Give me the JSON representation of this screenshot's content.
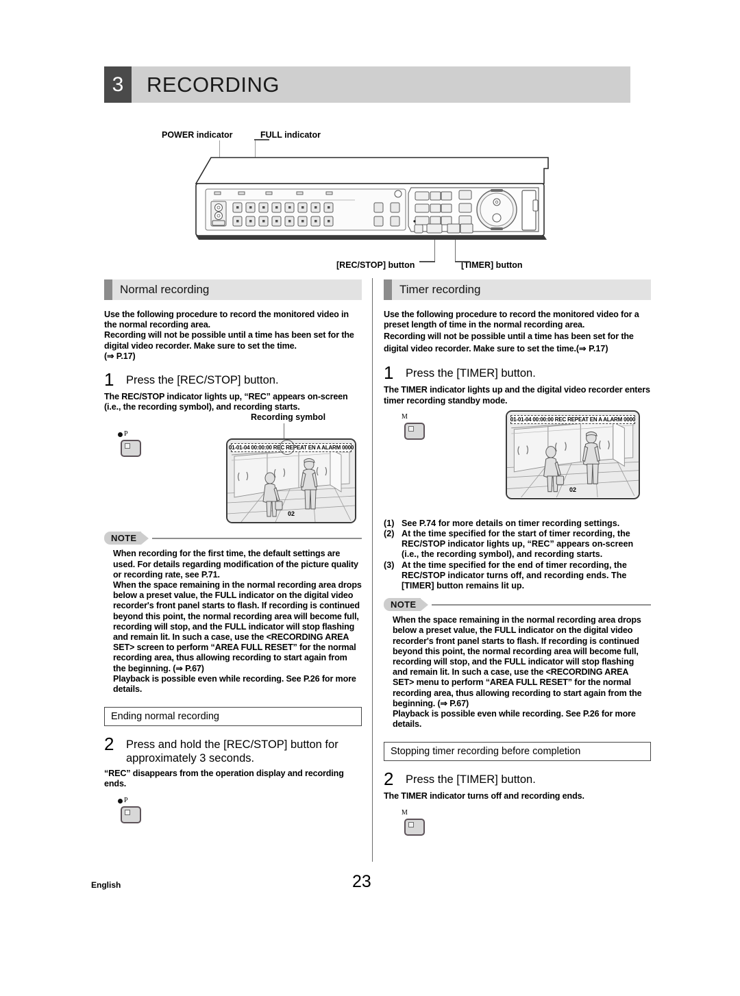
{
  "chapter": {
    "number": "3",
    "title": "RECORDING"
  },
  "device_callouts": {
    "power": "POWER indicator",
    "full": "FULL indicator",
    "recstop": "[REC/STOP] button",
    "timer": "[TIMER] button"
  },
  "left_column": {
    "section_title": "Normal recording",
    "intro": "Use the following procedure to record the monitored video in the normal recording area.",
    "intro2": "Recording will not be possible until a time has been set for the digital video recorder. Make sure to set the time.",
    "intro_ref": "(⇒ P.17)",
    "step1_num": "1",
    "step1_text": "Press the [REC/STOP] button.",
    "step1_desc": "The REC/STOP indicator lights up, “REC” appears on-screen (i.e., the recording symbol), and recording starts.",
    "button_dot_label": "P",
    "screen_label": "Recording symbol",
    "osd_text": "01-01-04 00:00:00 REC REPEAT EN A ALARM 0000",
    "camera_number": "02",
    "note_caption": "NOTE",
    "note_p1": "When recording for the first time, the default settings are used. For details regarding modification of the picture quality or recording rate, see P.71.",
    "note_p2": "When the space remaining in the normal recording area drops below a preset value, the FULL indicator on the digital video recorder's front panel starts to flash. If recording is continued beyond this point, the normal recording area will become full, recording will stop, and the FULL indicator will stop flashing and remain lit. In such a case, use the <RECORDING AREA SET> screen to perform “AREA FULL RESET” for the normal recording area, thus allowing recording to start again from the beginning. (⇒ P.67)",
    "note_p3": "Playback is possible even while recording. See P.26 for more details.",
    "subhead": "Ending normal recording",
    "step2_num": "2",
    "step2_text": "Press and hold the [REC/STOP] button for approximately 3 seconds.",
    "step2_desc": "“REC” disappears from the operation display and recording ends.",
    "button2_dot_label": "P"
  },
  "right_column": {
    "section_title": "Timer recording",
    "intro": "Use the following procedure to record the monitored video for a preset length of time in the normal recording area.",
    "intro2": "Recording will not be possible until a time has been set for the digital video recorder. Make sure to set the time.",
    "intro_ref": "(⇒ P.17)",
    "step1_num": "1",
    "step1_text": "Press the [TIMER] button.",
    "step1_desc": "The TIMER indicator lights up and the digital video recorder enters timer recording standby mode.",
    "button_label": "M",
    "osd_text": "01-01-04 00:00:00 REC REPEAT EN A ALARM 0000",
    "camera_number": "02",
    "list": [
      {
        "marker": "(1)",
        "text": "See P.74 for more details on timer recording settings."
      },
      {
        "marker": "(2)",
        "text": "At the time specified for the start of timer recording, the REC/STOP indicator lights up, “REC” appears on-screen (i.e., the recording symbol), and recording starts."
      },
      {
        "marker": "(3)",
        "text": "At the time specified for the end of timer recording, the REC/STOP indicator turns off, and recording ends. The [TIMER] button remains lit up."
      }
    ],
    "note_caption": "NOTE",
    "note_p1": "When the space remaining in the normal recording area drops below a preset value, the FULL indicator on the digital video recorder's front panel starts to flash. If recording is continued beyond this point, the normal recording area will become full, recording will stop, and the FULL indicator will stop flashing and remain lit. In such a case, use the <RECORDING AREA SET> menu to perform “AREA FULL RESET” for the normal recording area, thus allowing recording to start again from the beginning. (⇒ P.67)",
    "note_p2": "Playback is possible even while recording. See P.26 for more details.",
    "subhead": "Stopping timer recording before completion",
    "step2_num": "2",
    "step2_text": "Press the [TIMER] button.",
    "step2_desc": "The TIMER indicator turns off and recording ends.",
    "button2_label": "M"
  },
  "footer": {
    "language": "English",
    "page_number": "23"
  },
  "colors": {
    "chapter_num_bg": "#4a4a4a",
    "chapter_bar_bg": "#cfcfcf",
    "section_head_bg": "#e2e2e2",
    "section_tab_bg": "#8c8c8c",
    "note_cap_bg": "#cdcdcd"
  }
}
